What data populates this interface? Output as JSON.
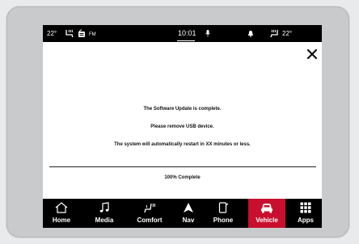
{
  "status_bar": {
    "temp_left": "22°",
    "radio_band": "FM",
    "clock": "10:01",
    "temp_right": "22°"
  },
  "dialog": {
    "line1": "The Software Update is complete.",
    "line2": "Please remove USB device.",
    "line3": "The system will automatically restart in XX minutes or less.",
    "progress_text": "100% Complete"
  },
  "nav": {
    "items": [
      {
        "label": "Home",
        "icon": "home-icon"
      },
      {
        "label": "Media",
        "icon": "music-note-icon"
      },
      {
        "label": "Comfort",
        "icon": "heated-seat-icon"
      },
      {
        "label": "Nav",
        "icon": "navigation-arrow-icon"
      },
      {
        "label": "Phone",
        "icon": "phone-icon"
      },
      {
        "label": "Vehicle",
        "icon": "car-icon",
        "active": true
      },
      {
        "label": "Apps",
        "icon": "apps-grid-icon"
      }
    ]
  },
  "colors": {
    "active_tab": "#c8102e",
    "background": "#000000",
    "dialog_bg": "#ffffff"
  }
}
